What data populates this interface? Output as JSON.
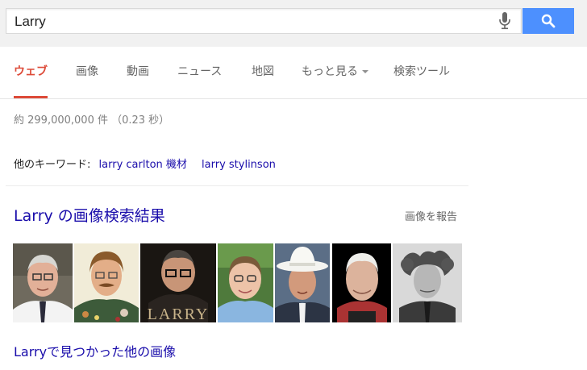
{
  "search": {
    "query": "Larry"
  },
  "tabs": [
    {
      "label": "ウェブ",
      "active": true
    },
    {
      "label": "画像"
    },
    {
      "label": "動画"
    },
    {
      "label": "ニュース"
    },
    {
      "label": "地図"
    },
    {
      "label": "もっと見る"
    },
    {
      "label": "検索ツール"
    }
  ],
  "stats": "約 299,000,000 件 （0.23 秒）",
  "related": {
    "label": "他のキーワード:",
    "links": [
      "larry carlton 機材",
      "larry stylinson"
    ]
  },
  "images": {
    "title": "Larry の画像検索結果",
    "report": "画像を報告",
    "thumbnail_overlay_text": "LARRY",
    "more_link": "Larryで見つかった他の画像"
  },
  "colors": {
    "accent_red": "#dd4b39",
    "link_blue": "#1a0dab",
    "search_button_blue": "#4d90fe"
  }
}
